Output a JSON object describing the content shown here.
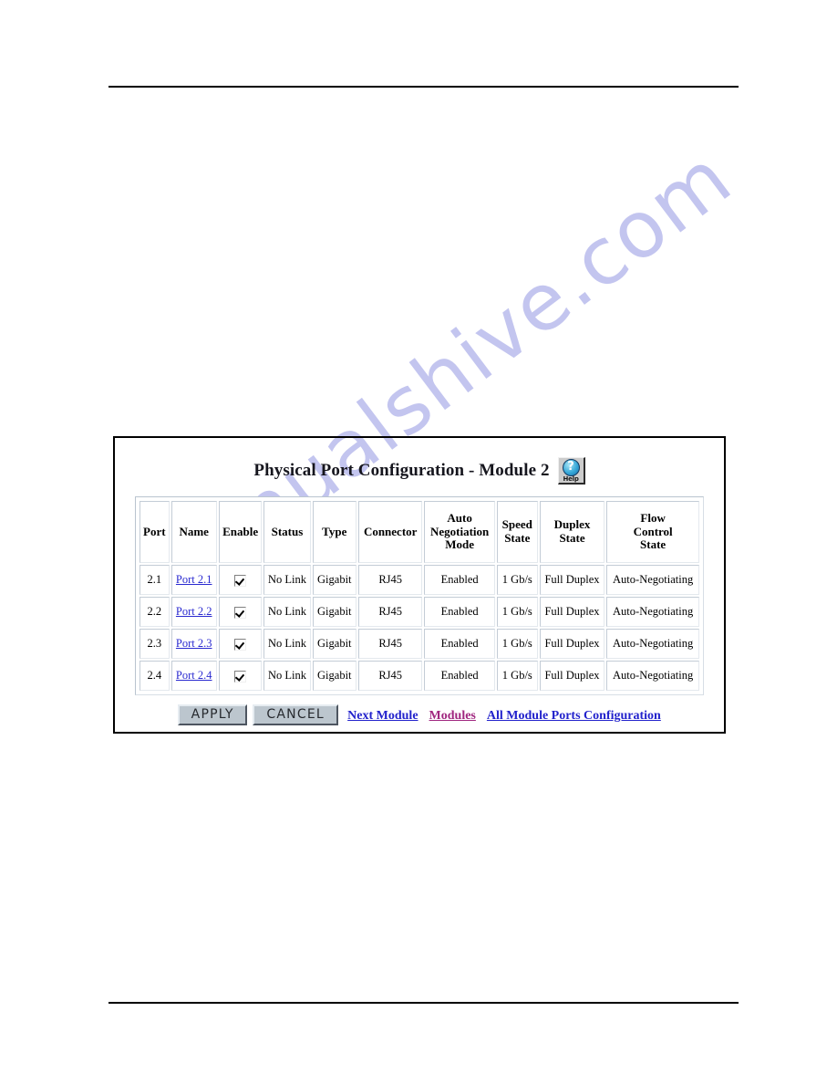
{
  "watermark": {
    "text": "manualshive.com"
  },
  "panel": {
    "title": "Physical Port Configuration - Module 2",
    "help_button": {
      "glyph": "?",
      "label": "Help",
      "icon": "help-question-icon"
    },
    "table": {
      "columns": [
        "Port",
        "Name",
        "Enable",
        "Status",
        "Type",
        "Connector",
        "Auto Negotiation Mode",
        "Speed State",
        "Duplex State",
        "Flow Control State"
      ],
      "columns_wrapped": [
        [
          "Port"
        ],
        [
          "Name"
        ],
        [
          "Enable"
        ],
        [
          "Status"
        ],
        [
          "Type"
        ],
        [
          "Connector"
        ],
        [
          "Auto",
          "Negotiation",
          "Mode"
        ],
        [
          "Speed",
          "State"
        ],
        [
          "Duplex",
          "State"
        ],
        [
          "Flow",
          "Control",
          "State"
        ]
      ],
      "rows": [
        {
          "port": "2.1",
          "name": "Port 2.1",
          "enable": true,
          "status": "No Link",
          "type": "Gigabit",
          "connector": "RJ45",
          "auto_negotiation_mode": "Enabled",
          "speed_state": "1 Gb/s",
          "duplex_state": "Full Duplex",
          "flow_control_state": "Auto-Negotiating"
        },
        {
          "port": "2.2",
          "name": "Port 2.2",
          "enable": true,
          "status": "No Link",
          "type": "Gigabit",
          "connector": "RJ45",
          "auto_negotiation_mode": "Enabled",
          "speed_state": "1 Gb/s",
          "duplex_state": "Full Duplex",
          "flow_control_state": "Auto-Negotiating"
        },
        {
          "port": "2.3",
          "name": "Port 2.3",
          "enable": true,
          "status": "No Link",
          "type": "Gigabit",
          "connector": "RJ45",
          "auto_negotiation_mode": "Enabled",
          "speed_state": "1 Gb/s",
          "duplex_state": "Full Duplex",
          "flow_control_state": "Auto-Negotiating"
        },
        {
          "port": "2.4",
          "name": "Port 2.4",
          "enable": true,
          "status": "No Link",
          "type": "Gigabit",
          "connector": "RJ45",
          "auto_negotiation_mode": "Enabled",
          "speed_state": "1 Gb/s",
          "duplex_state": "Full Duplex",
          "flow_control_state": "Auto-Negotiating"
        }
      ]
    },
    "actions": {
      "apply_label": "APPLY",
      "cancel_label": "CANCEL",
      "links": [
        {
          "label": "Next Module",
          "state": "unvisited"
        },
        {
          "label": "Modules",
          "state": "visited"
        },
        {
          "label": "All Module Ports Configuration",
          "state": "unvisited"
        }
      ]
    }
  },
  "colors": {
    "link_unvisited": "#2222cc",
    "link_visited": "#a0267f",
    "button_face": "#bcc6ce",
    "panel_border": "#000000",
    "watermark": "#c3c5ef"
  }
}
